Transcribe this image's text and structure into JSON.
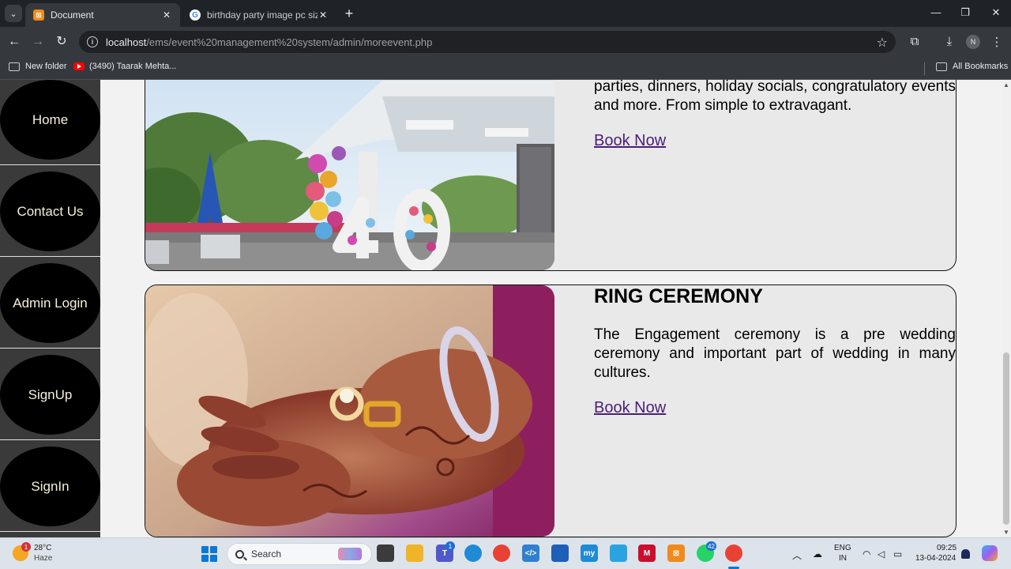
{
  "browser": {
    "tabs": [
      {
        "title": "Document",
        "active": true,
        "favicon": "xampp-icon"
      },
      {
        "title": "birthday party image pc size - G",
        "active": false,
        "favicon": "google-icon"
      }
    ],
    "url_host": "localhost",
    "url_path": "/ems/event%20management%20system/admin/moreevent.php",
    "bookmarks": [
      {
        "label": "New folder",
        "icon": "folder-icon"
      },
      {
        "label": "(3490) Taarak Mehta...",
        "icon": "youtube-icon"
      }
    ],
    "all_bookmarks_label": "All Bookmarks",
    "profile_initial": "N"
  },
  "sidebar": {
    "items": [
      {
        "label": "Home"
      },
      {
        "label": "Contact Us"
      },
      {
        "label": "Admin Login"
      },
      {
        "label": "SignUp"
      },
      {
        "label": "SignIn"
      }
    ]
  },
  "events": [
    {
      "title": "",
      "description": "parties, dinners, holiday socials, congratulatory events and more. From simple to extravagant.",
      "book_label": "Book Now",
      "image": "birthday-party-photo"
    },
    {
      "title": "RING CEREMONY",
      "description": "The Engagement ceremony is a pre wedding ceremony and important part of wedding in many cultures.",
      "book_label": "Book Now",
      "image": "ring-ceremony-photo"
    }
  ],
  "taskbar": {
    "weather_temp": "28°C",
    "weather_desc": "Haze",
    "weather_badge": "1",
    "search_label": "Search",
    "teams_badge": "1",
    "whatsapp_badge": "42",
    "language": "ENG",
    "region": "IN",
    "time": "09:25",
    "date": "13-04-2024"
  },
  "colors": {
    "link": "#4a1f7a",
    "sidebar_oval": "#000000",
    "sidebar_text": "#f5f0d8",
    "card_bg": "#e9e9e9"
  }
}
